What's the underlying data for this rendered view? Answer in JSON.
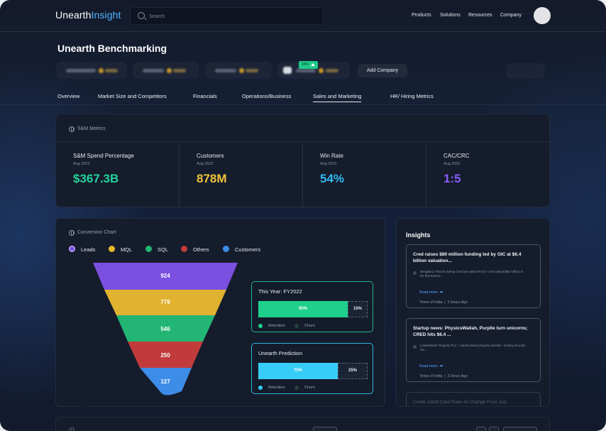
{
  "header": {
    "logo_primary": "Unearth",
    "logo_accent": "Insight",
    "search_placeholder": "Search",
    "nav": [
      "Products",
      "Solutions",
      "Resources",
      "Company"
    ]
  },
  "page": {
    "title": "Unearth Benchmarking",
    "add_company_label": "Add Company",
    "tabs": [
      "Overview",
      "Market Size and Competitors",
      "Financials",
      "Operations/Business",
      "Sales and Marketing",
      "HR/ Hiring Metrics"
    ],
    "active_tab": "Sales and Marketing"
  },
  "sm_metrics": {
    "title": "S&M Metrics",
    "items": [
      {
        "label": "S&M Spend Percentage",
        "date": "Aug 2022",
        "value": "$367.3B",
        "color": "#22d49a"
      },
      {
        "label": "Customers",
        "date": "Aug 2022",
        "value": "878M",
        "color": "#f2c53d"
      },
      {
        "label": "Win Rate",
        "date": "Aug 2022",
        "value": "54%",
        "color": "#33b9f2",
        "badge": "24%"
      },
      {
        "label": "CAC/CRC",
        "date": "Aug 2022",
        "value": "1:5",
        "color": "#8b5cf6"
      }
    ]
  },
  "conversion": {
    "title": "Conversion Chart",
    "legend": [
      {
        "label": "Leads",
        "color": "#7b4fe0"
      },
      {
        "label": "MQL",
        "color": "#e9b72a"
      },
      {
        "label": "SQL",
        "color": "#22b574"
      },
      {
        "label": "Others",
        "color": "#c23b3b"
      },
      {
        "label": "Customers",
        "color": "#3d8de8"
      }
    ],
    "funnel_values": [
      "924",
      "779",
      "546",
      "250",
      "127"
    ],
    "this_year": {
      "title": "This Year: FY2022",
      "retention": "90%",
      "churn": "10%",
      "retention_fraction": 0.82,
      "legend_retention": "Retention",
      "legend_churn": "Churn"
    },
    "prediction": {
      "title": "Unearth Prediction",
      "retention": "75%",
      "churn": "25%",
      "retention_fraction": 0.73,
      "legend_retention": "Retention",
      "legend_churn": "Churn"
    }
  },
  "insights": {
    "title": "Insights",
    "news": [
      {
        "title": "Cred raises $80 million funding led by GIC at $6.4 billion valuation...",
        "body": "Bengaluru: Fintech startup Cred has raised Rs 617 crore (about $80 million) in the first tranche...",
        "read_more": "Read more",
        "source": "Times of India",
        "time": "3 Hours Ago"
      },
      {
        "title": "Startup news: PhysicsWallah, Purplle turn unicorns; CRED hits $6.4 ...",
        "body": "LondonMetric Property PLC - London-based property investor - Notes just under 2%...",
        "read_more": "Read more",
        "source": "Times of India",
        "time": "3 Hours Ago"
      },
      {
        "title": "Credit, Debit Card Rules to Change From July"
      }
    ]
  }
}
